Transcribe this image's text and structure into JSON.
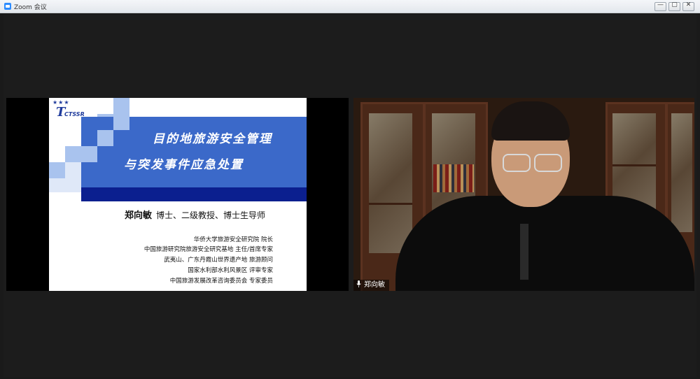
{
  "window": {
    "title": "Zoom 会议"
  },
  "window_controls": {
    "minimize": "—",
    "maximize": "▢",
    "close": "✕"
  },
  "slide": {
    "logo_text": "CTSSR",
    "title_line1": "目的地旅游安全管理",
    "title_line2": "与突发事件应急处置",
    "speaker_name": "郑向敏",
    "speaker_titles": "博士、二级教授、博士生导师",
    "affiliations": [
      "华侨大学旅游安全研究院   院长",
      "中国旅游研究院旅游安全研究基地  主任/首席专家",
      "武夷山、广东丹霞山世界遗产地      旅游顾问",
      "国家水利部水利风景区      评审专家",
      "中国旅游发展改革咨询委员会    专家委员"
    ],
    "colors": {
      "band": "#3b69c9",
      "dark_band": "#0b1f8f",
      "squares": "#a9c3ee"
    }
  },
  "participant": {
    "name": "郑向敏"
  },
  "colors": {
    "accent": "#2d8cff",
    "stage_bg": "#1c1c1c"
  }
}
